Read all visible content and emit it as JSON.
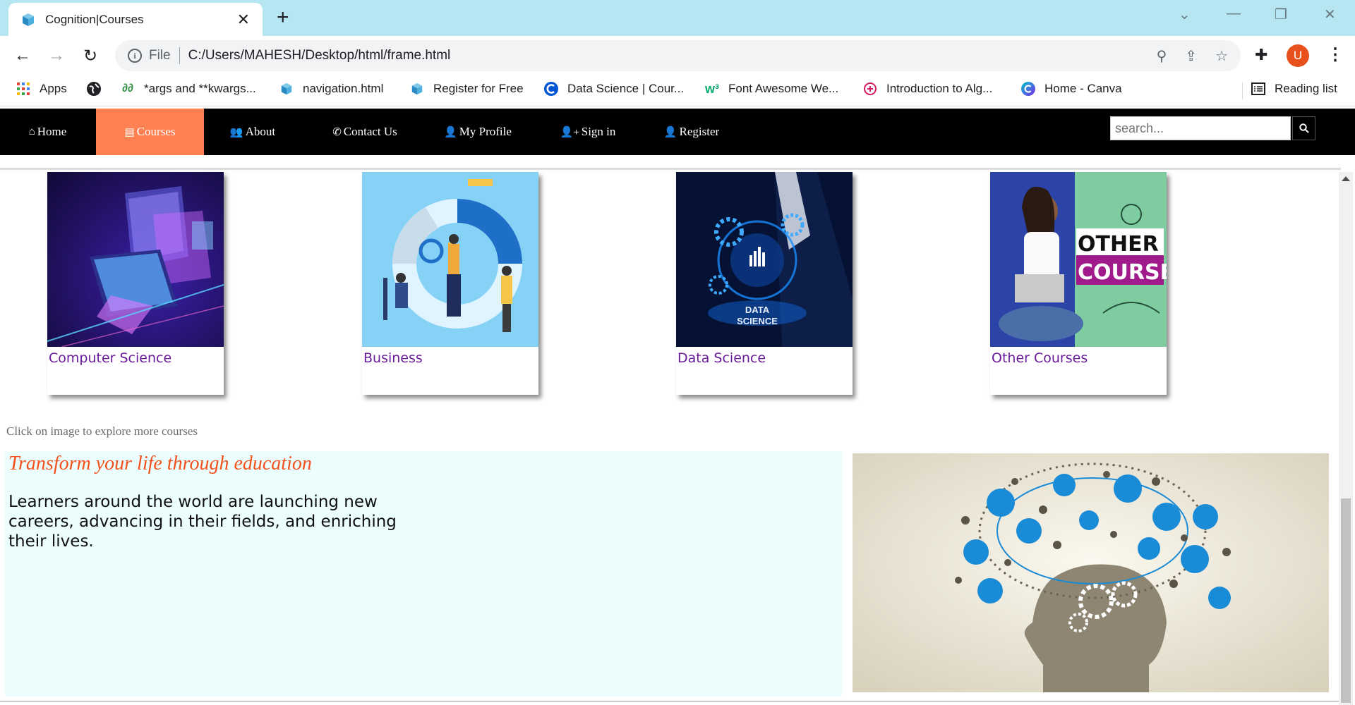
{
  "browser": {
    "tab_title": "Cognition|Courses",
    "url_scheme": "File",
    "url": "C:/Users/MAHESH/Desktop/html/frame.html",
    "profile_initial": "U",
    "bookmarks": [
      {
        "label": "Apps",
        "icon": "apps-grid-icon"
      },
      {
        "label": "",
        "icon": "globe-icon"
      },
      {
        "label": "*args and **kwargs...",
        "icon": "geeksforgeeks-icon"
      },
      {
        "label": "navigation.html",
        "icon": "html-file-icon"
      },
      {
        "label": "Register for Free",
        "icon": "html-file-icon"
      },
      {
        "label": "Data Science | Cour...",
        "icon": "c-logo-icon"
      },
      {
        "label": "Font Awesome We...",
        "icon": "w3schools-icon"
      },
      {
        "label": "Introduction to Alg...",
        "icon": "edu-icon"
      },
      {
        "label": "Home - Canva",
        "icon": "canva-icon"
      }
    ],
    "reading_list": "Reading list"
  },
  "site": {
    "nav": [
      {
        "label": "Home",
        "icon": "home-icon",
        "active": false
      },
      {
        "label": "Courses",
        "icon": "book-icon",
        "active": true
      },
      {
        "label": "About",
        "icon": "users-icon",
        "active": false
      },
      {
        "label": "Contact Us",
        "icon": "phone-icon",
        "active": false
      },
      {
        "label": "My Profile",
        "icon": "user-icon",
        "active": false
      },
      {
        "label": "Sign in",
        "icon": "user-plus-icon",
        "active": false
      },
      {
        "label": "Register",
        "icon": "user-icon",
        "active": false
      }
    ],
    "search_placeholder": "search...",
    "accent_color": "#ff8050",
    "courses": [
      {
        "label": "Computer Science"
      },
      {
        "label": "Business"
      },
      {
        "label": "Data Science"
      },
      {
        "label": "Other Courses",
        "image_text_1": "OTHER",
        "image_text_2": "COURSES"
      }
    ],
    "hint": "Click on image to explore more courses",
    "promo": {
      "title": "Transform your life through education",
      "body": "Learners around the world are launching new careers, advancing in their fields, and enriching their lives."
    }
  }
}
